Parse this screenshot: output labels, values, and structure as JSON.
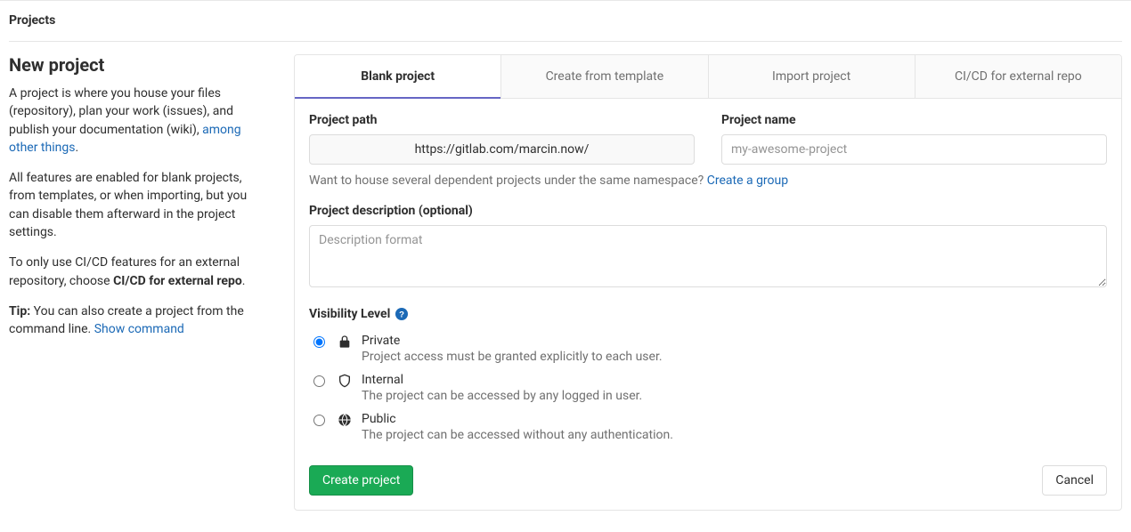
{
  "header": {
    "breadcrumb": "Projects"
  },
  "sidebar": {
    "title": "New project",
    "p1_a": "A project is where you house your files (repository), plan your work (issues), and publish your documentation (wiki), ",
    "p1_link": "among other things",
    "p1_b": ".",
    "p2": "All features are enabled for blank projects, from templates, or when importing, but you can disable them afterward in the project settings.",
    "p3_a": "To only use CI/CD features for an external repository, choose ",
    "p3_b": "CI/CD for external repo",
    "p3_c": ".",
    "tip_label": "Tip:",
    "tip_text": " You can also create a project from the command line. ",
    "tip_link": "Show command"
  },
  "tabs": [
    {
      "label": "Blank project"
    },
    {
      "label": "Create from template"
    },
    {
      "label": "Import project"
    },
    {
      "label": "CI/CD for external repo"
    }
  ],
  "form": {
    "path_label": "Project path",
    "path_value": "https://gitlab.com/marcin.now/",
    "name_label": "Project name",
    "name_placeholder": "my-awesome-project",
    "hint_a": "Want to house several dependent projects under the same namespace? ",
    "hint_link": "Create a group",
    "desc_label": "Project description (optional)",
    "desc_placeholder": "Description format",
    "visibility_label": "Visibility Level",
    "visibility": [
      {
        "title": "Private",
        "desc": "Project access must be granted explicitly to each user."
      },
      {
        "title": "Internal",
        "desc": "The project can be accessed by any logged in user."
      },
      {
        "title": "Public",
        "desc": "The project can be accessed without any authentication."
      }
    ],
    "submit": "Create project",
    "cancel": "Cancel"
  }
}
